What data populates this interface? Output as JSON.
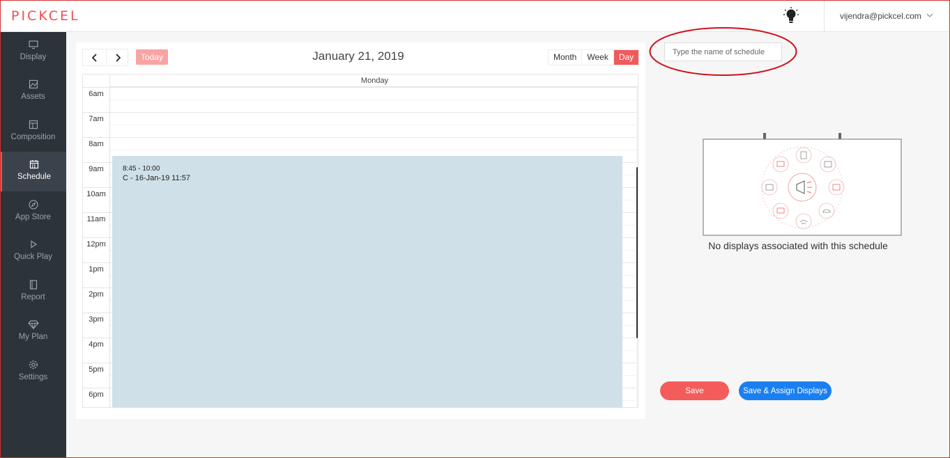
{
  "header": {
    "logo": "PICKCEL",
    "user_email": "vijendra@pickcel.com",
    "icons": [
      "bulb-icon",
      "chevron-down-icon"
    ]
  },
  "sidebar": {
    "items": [
      {
        "label": "Display",
        "icon": "monitor-icon"
      },
      {
        "label": "Assets",
        "icon": "image-icon"
      },
      {
        "label": "Composition",
        "icon": "layout-icon"
      },
      {
        "label": "Schedule",
        "icon": "calendar-icon",
        "active": true
      },
      {
        "label": "App Store",
        "icon": "compass-icon"
      },
      {
        "label": "Quick Play",
        "icon": "play-icon"
      },
      {
        "label": "Report",
        "icon": "report-icon"
      },
      {
        "label": "My Plan",
        "icon": "diamond-icon"
      },
      {
        "label": "Settings",
        "icon": "gear-icon"
      }
    ],
    "accent_color": "#f04e4e"
  },
  "calendar": {
    "prev_label": "‹",
    "next_label": "›",
    "today_label": "Today",
    "title": "January 21, 2019",
    "views": [
      "Month",
      "Week",
      "Day"
    ],
    "active_view": "Day",
    "day_header": "Monday",
    "hours": [
      "6am",
      "7am",
      "8am",
      "9am",
      "10am",
      "11am",
      "12pm",
      "1pm",
      "2pm",
      "3pm",
      "4pm",
      "5pm",
      "6pm"
    ],
    "event": {
      "time": "8:45 - 10:00",
      "name": "C - 16-Jan-19 11:57",
      "color": "#cfe0e8"
    }
  },
  "right_pane": {
    "schedule_name_placeholder": "Type the name of schedule",
    "no_displays_text": "No displays associated with this schedule",
    "save_label": "Save",
    "save_assign_label": "Save & Assign Displays",
    "save_color": "#f45c5c",
    "assign_color": "#1a7ff0"
  }
}
